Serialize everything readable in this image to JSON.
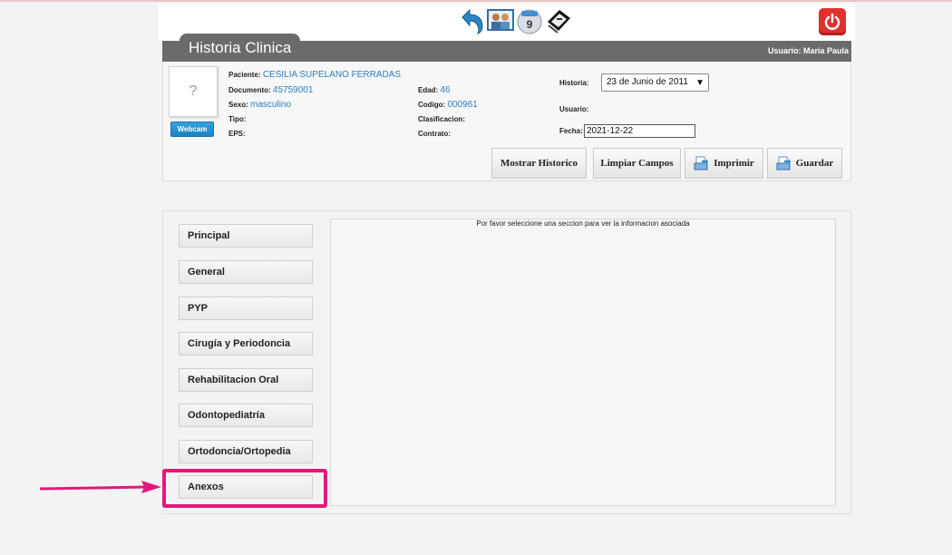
{
  "topbar": {
    "icons": [
      "back-arrow-icon",
      "users-icon",
      "calendar-icon",
      "monitor-icon",
      "power-icon"
    ],
    "calendar_day": "9"
  },
  "header": {
    "title": "Historia Clinica",
    "user_text": "Usuario: Maria Paula"
  },
  "patient": {
    "photo_placeholder": "?",
    "webcam_label": "Webcam",
    "paciente_label": "Paciente:",
    "paciente_value": "CESILIA SUPELANO FERRADAS",
    "documento_label": "Documento:",
    "documento_value": "45759001",
    "sexo_label": "Sexo:",
    "sexo_value": "masculino",
    "tipo_label": "Tipo:",
    "eps_label": "EPS:",
    "edad_label": "Edad:",
    "edad_value": "46",
    "codigo_label": "Codigo:",
    "codigo_value": "000961",
    "clasificacion_label": "Clasificacion:",
    "contrato_label": "Contrato:",
    "historia_label": "Historia:",
    "historia_selected": "23 de Junio de 2011",
    "usuario_label": "Usuario:",
    "fecha_label": "Fecha:",
    "fecha_value": "2021-12-22"
  },
  "actions": {
    "mostrar": "Mostrar Historico",
    "limpiar": "Limpiar Campos",
    "imprimir": "Imprimir",
    "guardar": "Guardar"
  },
  "sections": [
    "Principal",
    "General",
    "PYP",
    "Cirugía y Periodoncia",
    "Rehabilitacion Oral",
    "Odontopediatría",
    "Ortodoncia/Ortopedia",
    "Anexos"
  ],
  "content": {
    "message": "Por favor seleccione una seccion para ver la informacion asociada"
  },
  "colors": {
    "highlight": "#e2187c",
    "link": "#2e7ebf",
    "header": "#6b6b6b"
  }
}
